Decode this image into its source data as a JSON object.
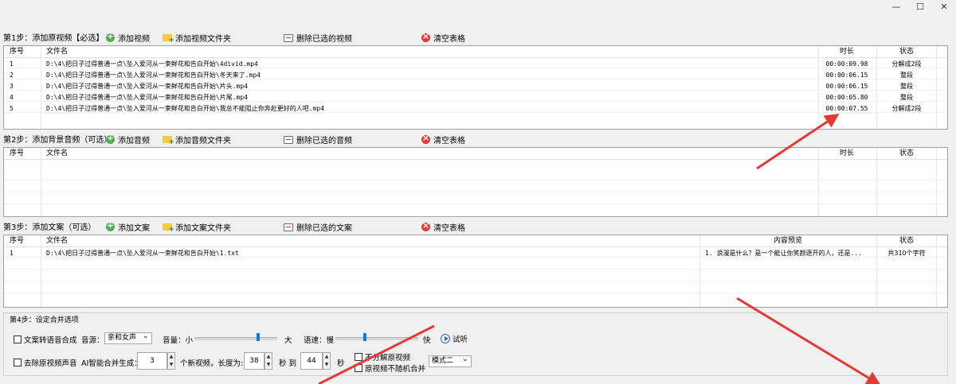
{
  "window": {
    "minimize": "—",
    "maximize": "☐",
    "close": "✕"
  },
  "steps": {
    "video": {
      "label": "第1步：添加原视频【必选】",
      "add": "添加视频",
      "add_folder": "添加视频文件夹",
      "delete": "删除已选的视频",
      "clear": "清空表格",
      "headers": [
        "序号",
        "文件名",
        "时长",
        "状态"
      ],
      "rows": [
        [
          "1",
          "D:\\4\\把日子过得普通一点\\坠入爱河从一束鲜花和告白开始\\4divid.mp4",
          "00:00:09.98",
          "分解成2段"
        ],
        [
          "2",
          "D:\\4\\把日子过得普通一点\\坠入爱河从一束鲜花和告白开始\\冬天来了.mp4",
          "00:00:06.15",
          "整段"
        ],
        [
          "3",
          "D:\\4\\把日子过得普通一点\\坠入爱河从一束鲜花和告白开始\\片头.mp4",
          "00:00:06.15",
          "整段"
        ],
        [
          "4",
          "D:\\4\\把日子过得普通一点\\坠入爱河从一束鲜花和告白开始\\片尾.mp4",
          "00:00:05.80",
          "整段"
        ],
        [
          "5",
          "D:\\4\\把日子过得普通一点\\坠入爱河从一束鲜花和告白开始\\我总不能阻止你奔赴更好的人吧.mp4",
          "00:00:07.55",
          "分解成2段"
        ]
      ]
    },
    "audio": {
      "label": "第2步：添加背景音频（可选）",
      "add": "添加音频",
      "add_folder": "添加音频文件夹",
      "delete": "删除已选的音频",
      "clear": "清空表格",
      "headers": [
        "序号",
        "文件名",
        "时长",
        "状态"
      ]
    },
    "text": {
      "label": "第3步：添加文案（可选）",
      "add": "添加文案",
      "add_folder": "添加文案文件夹",
      "delete": "删除已选的文案",
      "clear": "清空表格",
      "headers": [
        "序号",
        "文件名",
        "内容预览",
        "状态"
      ],
      "rows": [
        [
          "1",
          "D:\\4\\把日子过得普通一点\\坠入爱河从一束鲜花和告白开始\\1.txt",
          "1. 浪漫是什么？是一个能让你笑颜逐开的人，还是...",
          "共310个字符"
        ]
      ]
    },
    "options": {
      "legend": "第4步：设定合并选项",
      "tts": "文案转语音合成",
      "voice_label": "音源：",
      "voice_value": "亲和女声",
      "volume_label": "音量：小",
      "volume_max": "大",
      "volume_level": 0.78,
      "speed_label": "语速：慢",
      "speed_max": "快",
      "speed_level": 0.35,
      "preview": "试听",
      "remove_sound": "去除原视频声音",
      "ai_label": "AI智能合并生成：",
      "count": "3",
      "length_label": "个新视频，长度为:",
      "len_from": "38",
      "sec1": "秒 到",
      "len_to": "44",
      "sec2": "秒",
      "no_split": "不分解原视频",
      "no_random": "原视频不随机合并",
      "mode": "模式二"
    }
  }
}
